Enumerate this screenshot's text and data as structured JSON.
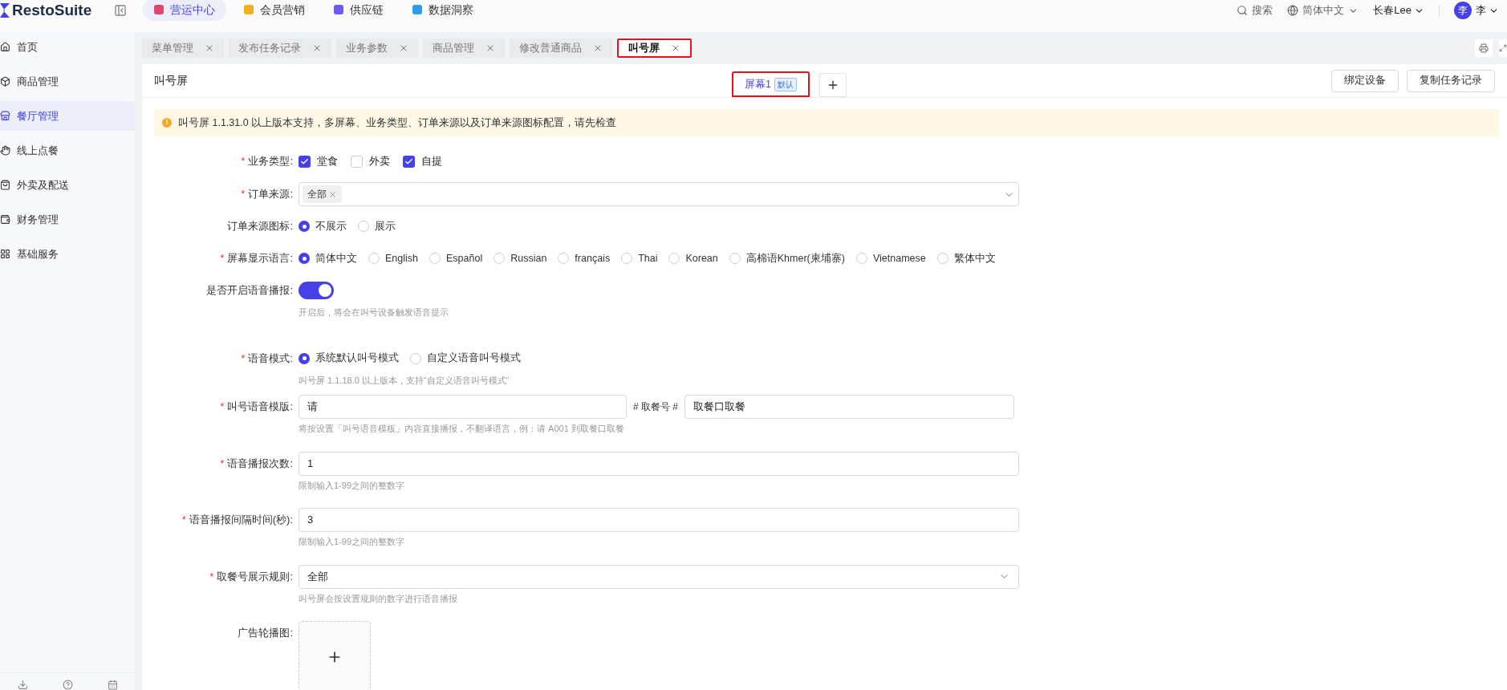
{
  "brand": "RestoSuite",
  "top_nav": [
    {
      "label": "营运中心",
      "selected": true
    },
    {
      "label": "会员营销",
      "selected": false
    },
    {
      "label": "供应链",
      "selected": false
    },
    {
      "label": "数据洞察",
      "selected": false
    }
  ],
  "header_right": {
    "search": "搜索",
    "language": "简体中文",
    "store": "长春Lee",
    "avatar": "李",
    "user": "李"
  },
  "sidebar": [
    {
      "label": "首页",
      "selected": false
    },
    {
      "label": "商品管理",
      "selected": false
    },
    {
      "label": "餐厅管理",
      "selected": true
    },
    {
      "label": "线上点餐",
      "selected": false
    },
    {
      "label": "外卖及配送",
      "selected": false
    },
    {
      "label": "财务管理",
      "selected": false
    },
    {
      "label": "基础服务",
      "selected": false
    }
  ],
  "page_tabs": [
    {
      "label": "菜单管理",
      "selected": false,
      "highlighted": false
    },
    {
      "label": "发布任务记录",
      "selected": false,
      "highlighted": false
    },
    {
      "label": "业务参数",
      "selected": false,
      "highlighted": false
    },
    {
      "label": "商品管理",
      "selected": false,
      "highlighted": false
    },
    {
      "label": "修改普通商品",
      "selected": false,
      "highlighted": false
    },
    {
      "label": "叫号屏",
      "selected": true,
      "highlighted": true
    }
  ],
  "page_title": "叫号屏",
  "required_mark": "*",
  "alert_icon": "!",
  "screen_tabs": [
    {
      "label": "屏幕1",
      "badge": "默认",
      "selected": true,
      "highlighted": true
    }
  ],
  "actions": [
    "绑定设备",
    "复制任务记录"
  ],
  "alert": "叫号屏 1.1.31.0 以上版本支持，多屏幕、业务类型、订单来源以及订单来源图标配置，请先检查",
  "form": [
    {
      "kind": "checkbox",
      "label": "业务类型:",
      "required": true,
      "options": [
        {
          "label": "堂食",
          "checked": true
        },
        {
          "label": "外卖",
          "checked": false
        },
        {
          "label": "自提",
          "checked": true
        }
      ]
    },
    {
      "kind": "tags",
      "label": "订单来源:",
      "required": true,
      "tags": [
        "全部"
      ]
    },
    {
      "kind": "radio",
      "label": "订单来源图标:",
      "required": false,
      "options": [
        {
          "label": "不展示",
          "selected": true
        },
        {
          "label": "展示",
          "selected": false
        }
      ]
    },
    {
      "kind": "radio",
      "label": "屏幕显示语言:",
      "required": true,
      "options": [
        {
          "label": "简体中文",
          "selected": true
        },
        {
          "label": "English",
          "selected": false
        },
        {
          "label": "Español",
          "selected": false
        },
        {
          "label": "Russian",
          "selected": false
        },
        {
          "label": "français",
          "selected": false
        },
        {
          "label": "Thai",
          "selected": false
        },
        {
          "label": "Korean",
          "selected": false
        },
        {
          "label": "高棉语Khmer(柬埔寨)",
          "selected": false
        },
        {
          "label": "Vietnamese",
          "selected": false
        },
        {
          "label": "繁体中文",
          "selected": false
        }
      ]
    },
    {
      "kind": "switch",
      "label": "是否开启语音播报:",
      "required": false,
      "on": true,
      "hint": "开启后，将会在叫号设备触发语音提示"
    },
    {
      "kind": "radio",
      "label": "语音模式:",
      "required": true,
      "options": [
        {
          "label": "系统默认叫号模式",
          "selected": true
        },
        {
          "label": "自定义语音叫号模式",
          "selected": false
        }
      ],
      "hint": "叫号屏 1.1.18.0 以上版本，支持“自定义语音叫号模式”"
    },
    {
      "kind": "template",
      "label": "叫号语音模版:",
      "required": true,
      "value": "请",
      "middle": "# 取餐号 #",
      "value2": "取餐口取餐",
      "hint": "将按设置「叫号语音模板」内容直接播报，不翻译语言，例：请 A001 到取餐口取餐"
    },
    {
      "kind": "text",
      "label": "语音播报次数:",
      "required": true,
      "value": "1",
      "hint": "限制输入1-99之间的整数字"
    },
    {
      "kind": "text",
      "label": "语音播报间隔时间(秒):",
      "required": true,
      "value": "3",
      "hint": "限制输入1-99之间的整数字"
    },
    {
      "kind": "select",
      "label": "取餐号展示规则:",
      "required": true,
      "value": "全部",
      "hint": "叫号屏会按设置规则的数字进行语音播报"
    },
    {
      "kind": "upload",
      "label": "广告轮播图:",
      "required": false
    }
  ]
}
